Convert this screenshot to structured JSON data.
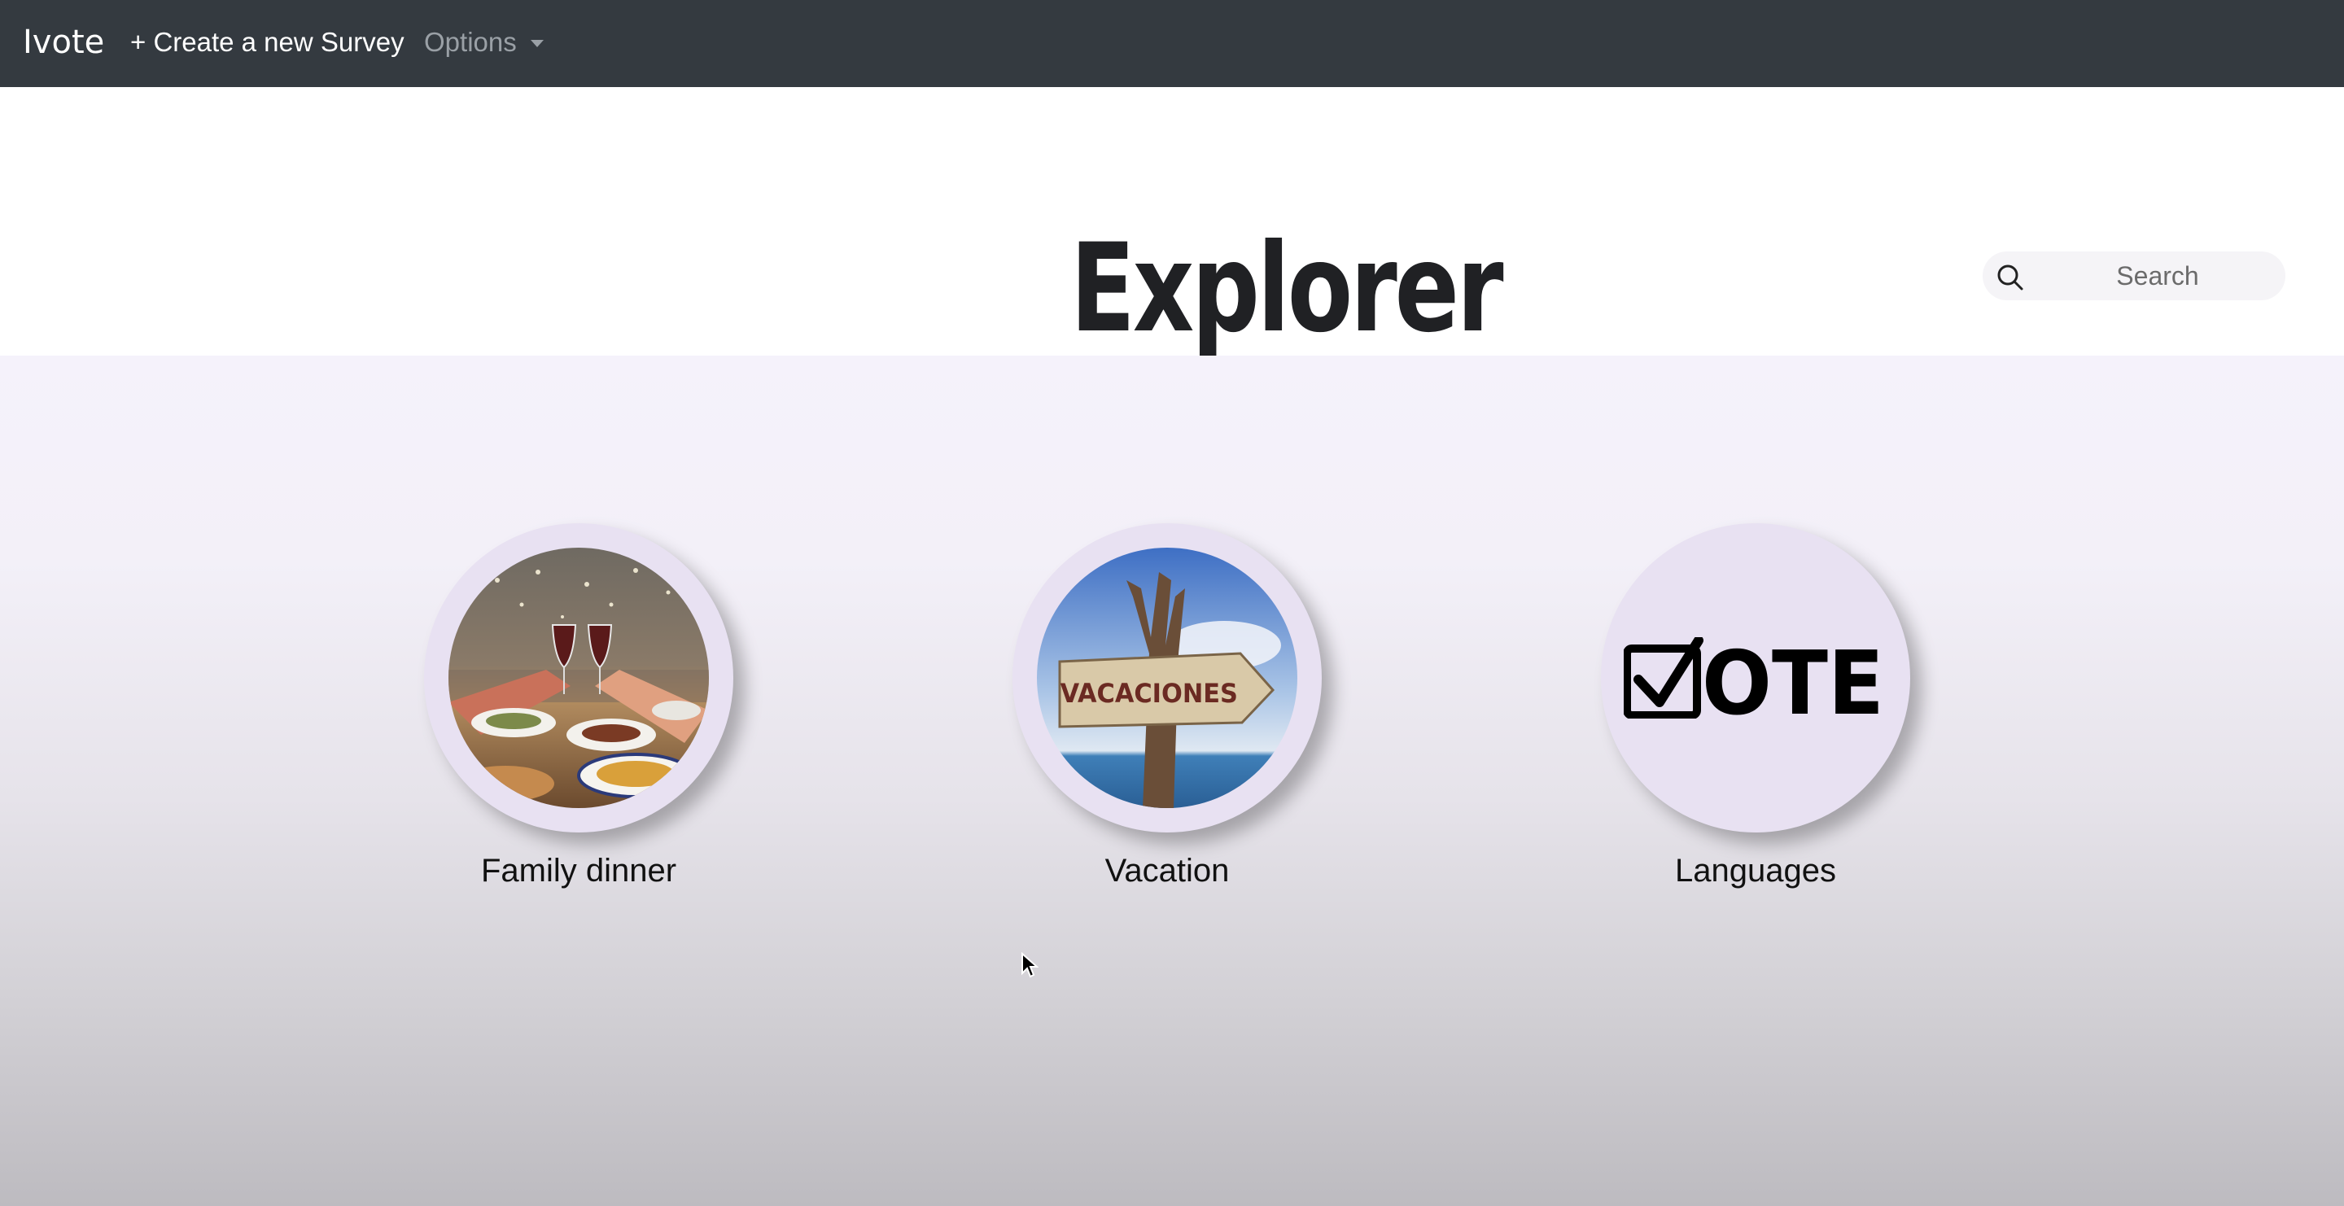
{
  "navbar": {
    "brand": "Ivote",
    "create_label": "+ Create a new Survey",
    "options_label": "Options"
  },
  "header": {
    "title": "Explorer"
  },
  "search": {
    "placeholder": "Search"
  },
  "categories": [
    {
      "label": "Family dinner",
      "icon": "dinner-photo"
    },
    {
      "label": "Vacation",
      "icon": "vacaciones-sign-photo"
    },
    {
      "label": "Languages",
      "icon": "vote-logo",
      "logo_text": "VOTE"
    }
  ],
  "colors": {
    "navbar_bg": "#343a40",
    "circle_bg": "#e8e1f2",
    "title_color": "#202124"
  }
}
